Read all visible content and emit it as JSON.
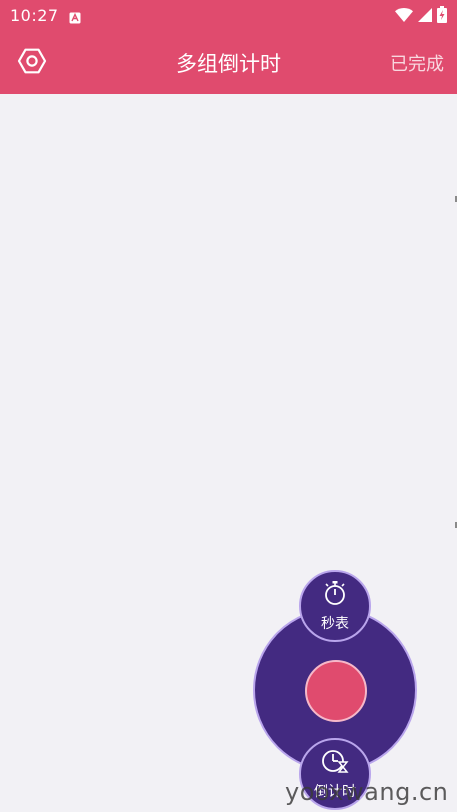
{
  "status_bar": {
    "time": "10:27",
    "icons": [
      "notification-icon",
      "wifi-icon",
      "signal-icon",
      "battery-charging-icon"
    ]
  },
  "app_bar": {
    "title": "多组倒计时",
    "action_label": "已完成",
    "settings_icon": "settings-icon"
  },
  "fab_menu": {
    "stopwatch": {
      "label": "秒表",
      "icon": "stopwatch-icon"
    },
    "countdown": {
      "label": "倒计时",
      "icon": "countdown-clock-icon"
    }
  },
  "watermark": "yooxwang.cn",
  "colors": {
    "primary": "#e04b6e",
    "fab_purple": "#432a81",
    "fab_border": "#b9a5ec",
    "background": "#f2f1f5"
  }
}
